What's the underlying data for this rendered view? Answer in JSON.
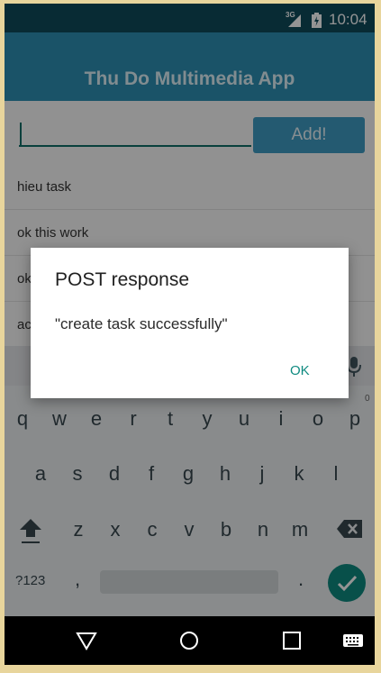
{
  "status_bar": {
    "network": "3G",
    "time": "10:04"
  },
  "app_bar": {
    "title": "Thu Do Multimedia App"
  },
  "input": {
    "value": "",
    "placeholder": ""
  },
  "add_button": {
    "label": "Add!"
  },
  "tasks": [
    {
      "label": "hieu task"
    },
    {
      "label": "ok this work"
    },
    {
      "label": "ok"
    },
    {
      "label": "ac"
    }
  ],
  "dialog": {
    "title": "POST response",
    "message": "\"create task successfully\"",
    "ok_label": "OK"
  },
  "keyboard": {
    "row1": [
      "q",
      "w",
      "e",
      "r",
      "t",
      "y",
      "u",
      "i",
      "o",
      "p"
    ],
    "row1_hint": "0",
    "row2": [
      "a",
      "s",
      "d",
      "f",
      "g",
      "h",
      "j",
      "k",
      "l"
    ],
    "row3": [
      "z",
      "x",
      "c",
      "v",
      "b",
      "n",
      "m"
    ],
    "symbols_label": "?123",
    "comma": ",",
    "period": "."
  },
  "colors": {
    "accent": "#0f8a80",
    "app_bar": "#2e8fb3",
    "status_bar": "#0f4a5a"
  }
}
